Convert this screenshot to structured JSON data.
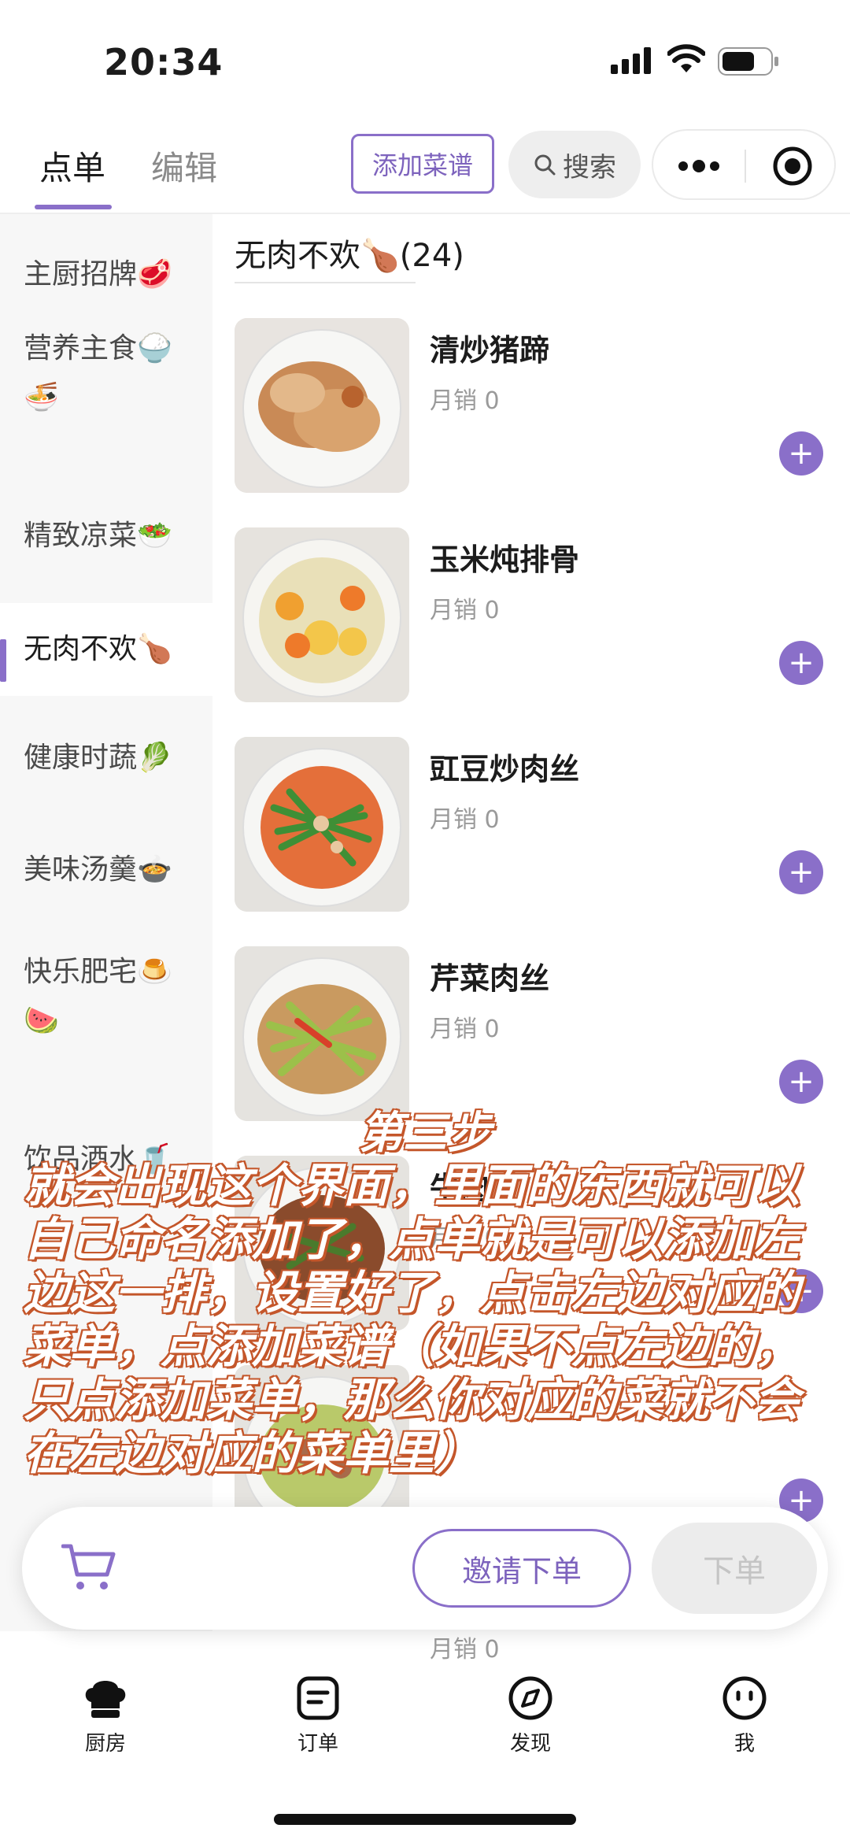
{
  "status_bar": {
    "time": "20:34"
  },
  "header": {
    "tabs": [
      {
        "label": "点单"
      },
      {
        "label": "编辑"
      }
    ],
    "add_recipe_label": "添加菜谱",
    "search_label": "搜索"
  },
  "sidebar": {
    "items": [
      {
        "label": "主厨招牌🥩"
      },
      {
        "label": "营养主食🍚🍜"
      },
      {
        "label": "精致凉菜🥗"
      },
      {
        "label": "无肉不欢🍗"
      },
      {
        "label": "健康时蔬🥬"
      },
      {
        "label": "美味汤羹🍲"
      },
      {
        "label": "快乐肥宅🍮🍉"
      },
      {
        "label": "饮品酒水🥤"
      }
    ]
  },
  "category": {
    "title": "无肉不欢🍗(24)"
  },
  "dishes": [
    {
      "name": "清炒猪蹄",
      "sales": "月销 0"
    },
    {
      "name": "玉米炖排骨",
      "sales": "月销 0"
    },
    {
      "name": "豇豆炒肉丝",
      "sales": "月销 0"
    },
    {
      "name": "芹菜肉丝",
      "sales": "月销 0"
    },
    {
      "name": "牛肉",
      "sales": "月销 0"
    },
    {
      "name": "",
      "sales": "月销 0"
    }
  ],
  "cart_bar": {
    "invite_label": "邀请下单",
    "order_label": "下单"
  },
  "bottom_nav": [
    {
      "label": "厨房",
      "icon": "chef-hat-icon"
    },
    {
      "label": "订单",
      "icon": "order-icon"
    },
    {
      "label": "发现",
      "icon": "compass-icon"
    },
    {
      "label": "我",
      "icon": "smiley-icon"
    }
  ],
  "overlay": {
    "title": "第三步",
    "body": "就会出现这个界面，里面的东西就可以自己命名添加了，点单就是可以添加左边这一排，设置好了，点击左边对应的菜单，点添加菜谱（如果不点左边的，只点添加菜单，那么你对应的菜就不会在左边对应的菜单里）"
  },
  "colors": {
    "accent": "#8a6fc9",
    "overlay_stroke": "#c4562a"
  }
}
